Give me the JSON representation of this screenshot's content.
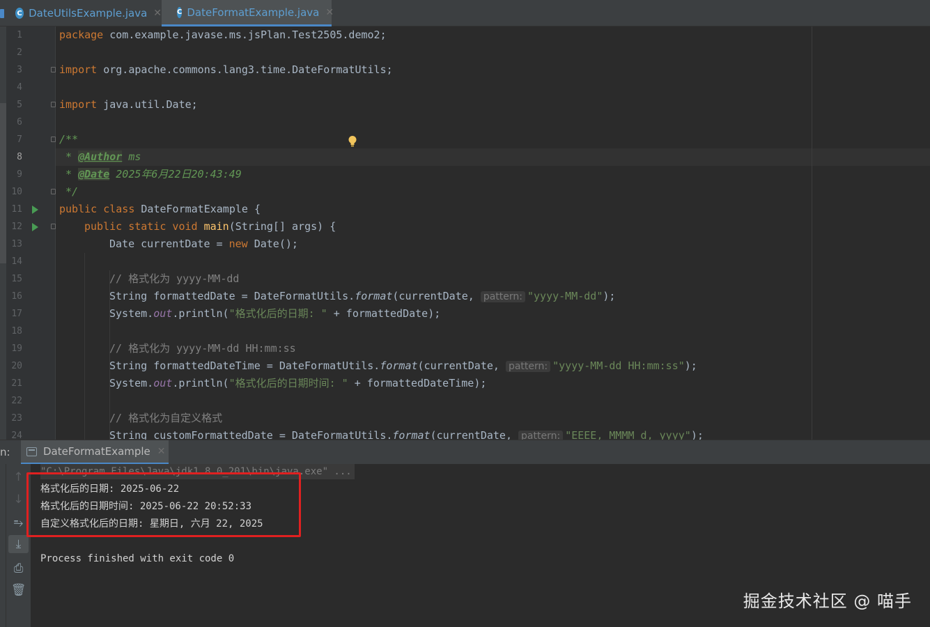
{
  "tabs": [
    {
      "label": "DateUtilsExample.java",
      "icon": "java-class-icon",
      "active": false
    },
    {
      "label": "DateFormatExample.java",
      "icon": "java-class-icon",
      "active": true
    }
  ],
  "editor": {
    "current_line": 8,
    "lines": [
      {
        "n": "1"
      },
      {
        "n": "2"
      },
      {
        "n": "3"
      },
      {
        "n": "4"
      },
      {
        "n": "5"
      },
      {
        "n": "6"
      },
      {
        "n": "7"
      },
      {
        "n": "8"
      },
      {
        "n": "9"
      },
      {
        "n": "10"
      },
      {
        "n": "11"
      },
      {
        "n": "12"
      },
      {
        "n": "13"
      },
      {
        "n": "14"
      },
      {
        "n": "15"
      },
      {
        "n": "16"
      },
      {
        "n": "17"
      },
      {
        "n": "18"
      },
      {
        "n": "19"
      },
      {
        "n": "20"
      },
      {
        "n": "21"
      },
      {
        "n": "22"
      },
      {
        "n": "23"
      },
      {
        "n": "24"
      }
    ],
    "code": {
      "l1_kw": "package",
      "l1_rest": " com.example.javase.ms.jsPlan.Test2505.demo2;",
      "l3_kw": "import",
      "l3_rest": " org.apache.commons.lang3.time.DateFormatUtils;",
      "l5_kw": "import",
      "l5_rest": " java.util.Date;",
      "l7": "/**",
      "l8_star": " * ",
      "l8_tag": "@Author",
      "l8_val": " ms",
      "l9_star": " * ",
      "l9_tag": "@Date",
      "l9_val": " 2025年6月22日20:43:49",
      "l10": " */",
      "l11_kw": "public class",
      "l11_rest": " DateFormatExample {",
      "l12_kw": "public static void",
      "l12_name": " main",
      "l12_rest": "(String[] args) {",
      "l13_a": "Date currentDate = ",
      "l13_kw": "new",
      "l13_b": " Date();",
      "l15": "// 格式化为 yyyy-MM-dd",
      "l16_a": "String formattedDate = DateFormatUtils.",
      "l16_fn": "format",
      "l16_b": "(currentDate, ",
      "l16_hint": "pattern:",
      "l16_str": "\"yyyy-MM-dd\"",
      "l16_c": ");",
      "l17_a": "System.",
      "l17_out": "out",
      "l17_b": ".println(",
      "l17_str": "\"格式化后的日期: \"",
      "l17_c": " + formattedDate);",
      "l19": "// 格式化为 yyyy-MM-dd HH:mm:ss",
      "l20_a": "String formattedDateTime = DateFormatUtils.",
      "l20_fn": "format",
      "l20_b": "(currentDate, ",
      "l20_hint": "pattern:",
      "l20_str": "\"yyyy-MM-dd HH:mm:ss\"",
      "l20_c": ");",
      "l21_a": "System.",
      "l21_out": "out",
      "l21_b": ".println(",
      "l21_str": "\"格式化后的日期时间: \"",
      "l21_c": " + formattedDateTime);",
      "l23": "// 格式化为自定义格式",
      "l24_a": "String customFormattedDate = DateFormatUtils.",
      "l24_fn": "format",
      "l24_b": "(currentDate, ",
      "l24_hint": "pattern:",
      "l24_str": "\"EEEE, MMMM d, yyyy\"",
      "l24_c": ");"
    }
  },
  "run_panel": {
    "label": "n:",
    "tab_label": "DateFormatExample",
    "command_line": "\"C:\\Program Files\\Java\\jdk1.8.0_201\\bin\\java.exe\" ...",
    "output": [
      "格式化后的日期: 2025-06-22",
      "格式化后的日期时间: 2025-06-22 20:52:33",
      "自定义格式化后的日期: 星期日, 六月 22, 2025"
    ],
    "exit_message": "Process finished with exit code 0",
    "toolbar_icons": [
      "arrow-up-icon",
      "arrow-down-icon",
      "soft-wrap-icon",
      "scroll-to-end-icon",
      "print-icon",
      "trash-icon"
    ]
  },
  "watermark": "掘金技术社区 @ 喵手",
  "colors": {
    "background": "#2b2b2b",
    "keyword": "#cc7832",
    "string": "#6a8759",
    "comment": "#808080",
    "doc_comment": "#629755",
    "static_field": "#9876aa",
    "accent": "#4a88c7",
    "highlight_box": "#e02020"
  }
}
